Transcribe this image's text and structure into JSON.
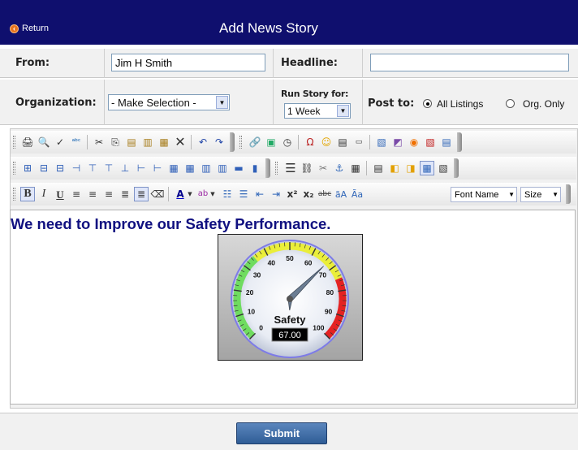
{
  "header": {
    "title": "Add News Story",
    "return_label": "Return"
  },
  "form": {
    "from_label": "From:",
    "from_value": "Jim H Smith",
    "headline_label": "Headline:",
    "headline_value": "",
    "organization_label": "Organization:",
    "organization_value": "- Make Selection -",
    "run_story_label": "Run Story for:",
    "run_story_value": "1 Week",
    "post_to_label": "Post to:",
    "post_options": [
      {
        "label": "All Listings",
        "checked": true
      },
      {
        "label": "Org. Only",
        "checked": false
      }
    ]
  },
  "toolbar": {
    "font_name": "Font Name",
    "size": "Size"
  },
  "editor": {
    "text": "We need to Improve our Safety Performance.",
    "gauge": {
      "label": "Safety",
      "value": 67.0,
      "readout": "67.00",
      "min": 0,
      "max": 100,
      "ticks": [
        "0",
        "10",
        "20",
        "30",
        "40",
        "50",
        "60",
        "70",
        "80",
        "90",
        "100"
      ],
      "zone_colors": {
        "low": "#6fdc5f",
        "mid": "#eaee3a",
        "high": "#e42222"
      }
    }
  },
  "footer": {
    "submit_label": "Submit"
  },
  "colors": {
    "title_bar": "#0f0f6e",
    "story_text": "#101080",
    "submit": "#3f6ca6"
  }
}
